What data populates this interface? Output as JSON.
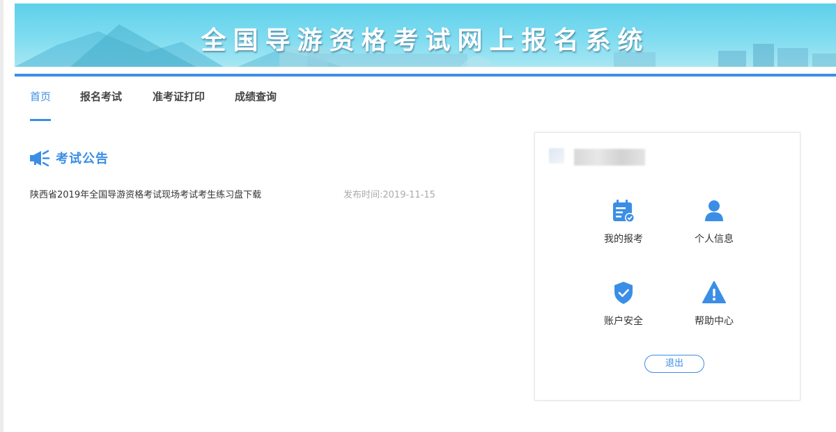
{
  "banner": {
    "title": "全国导游资格考试网上报名系统"
  },
  "nav": {
    "items": [
      {
        "label": "首页",
        "active": true
      },
      {
        "label": "报名考试",
        "active": false
      },
      {
        "label": "准考证打印",
        "active": false
      },
      {
        "label": "成绩查询",
        "active": false
      }
    ]
  },
  "announcements": {
    "title": "考试公告",
    "items": [
      {
        "text": "陕西省2019年全国导游资格考试现场考试考生练习盘下载",
        "date": "发布时间:2019-11-15"
      }
    ]
  },
  "user_card": {
    "menu": [
      {
        "label": "我的报考",
        "icon": "calendar-check-icon"
      },
      {
        "label": "个人信息",
        "icon": "user-icon"
      },
      {
        "label": "账户安全",
        "icon": "shield-check-icon"
      },
      {
        "label": "帮助中心",
        "icon": "warning-triangle-icon"
      }
    ],
    "logout_label": "退出"
  },
  "colors": {
    "accent": "#3b8ee6",
    "banner": "#6fd6ee"
  }
}
